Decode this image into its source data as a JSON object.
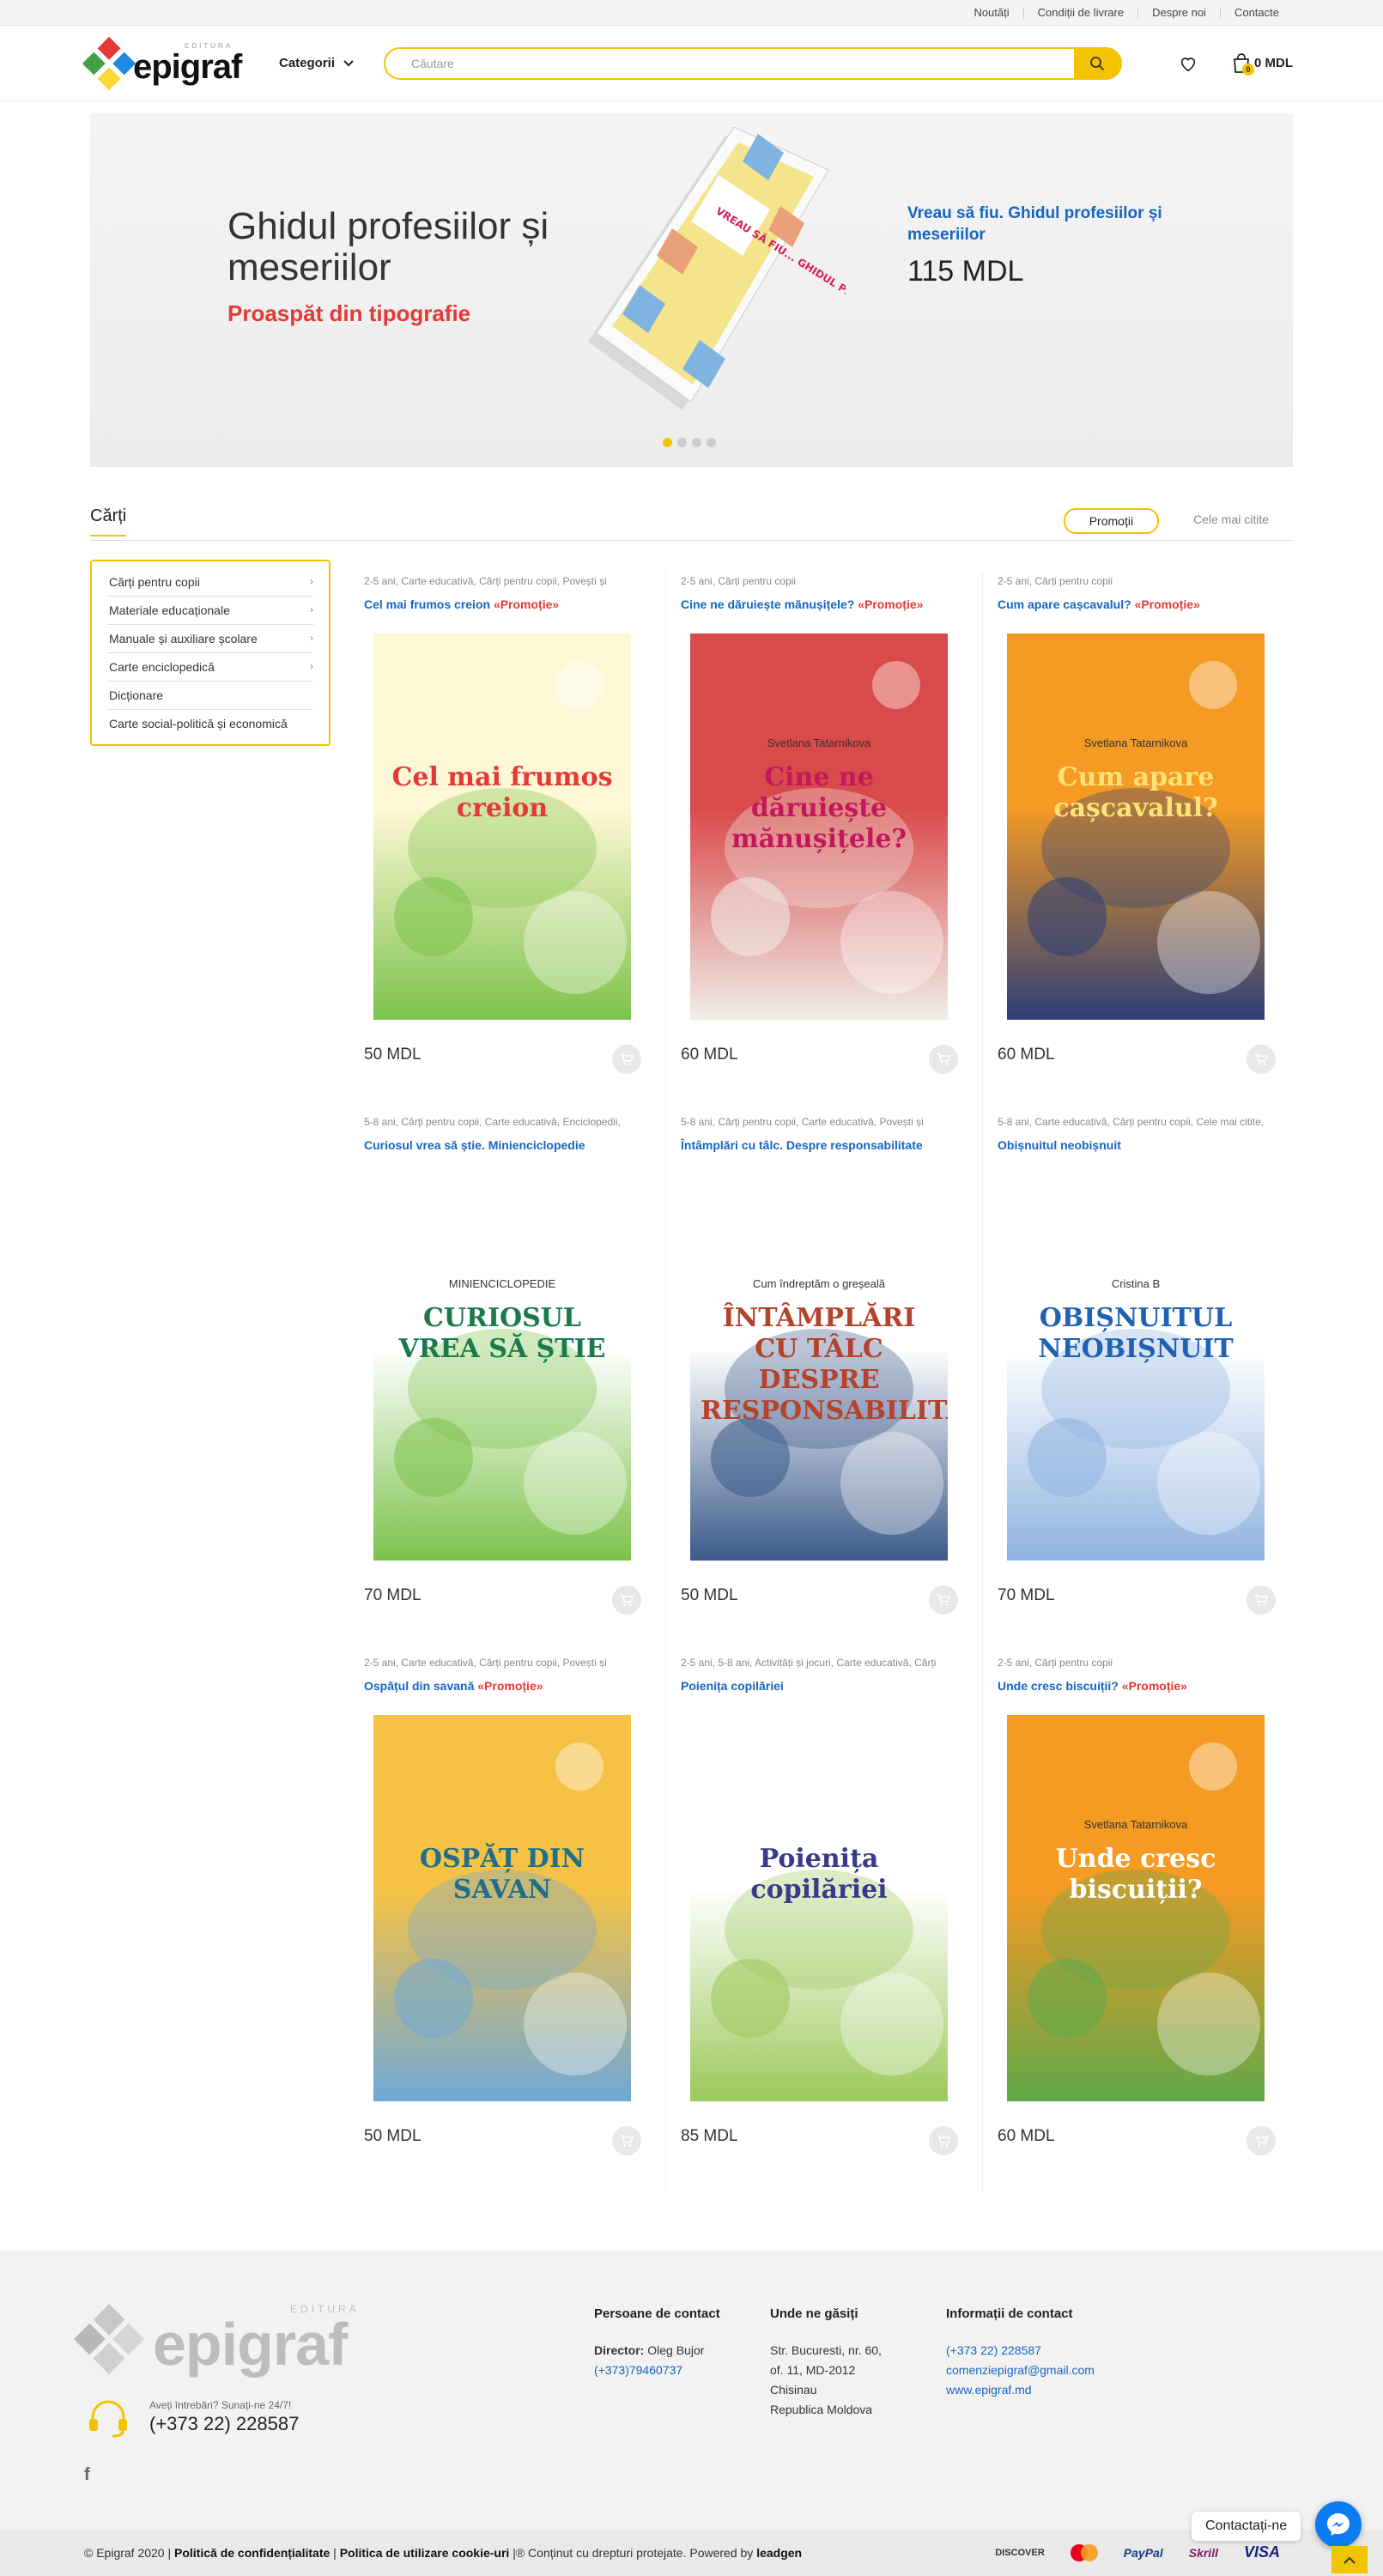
{
  "topbar": {
    "links": [
      "Noutăți",
      "Condiții de livrare",
      "Despre noi",
      "Contacte"
    ]
  },
  "header": {
    "logo_small": "EDITURA",
    "logo_big": "epigraf",
    "categories_label": "Categorii",
    "search_placeholder": "Căutare",
    "cart_total": "0 MDL",
    "cart_count": "0"
  },
  "banner": {
    "title": "Ghidul profesiilor și meseriilor",
    "subtitle": "Proaspăt din tipografie",
    "product_name": "Vreau să fiu. Ghidul profesiilor și meseriilor",
    "price": "115 MDL",
    "book_title": "VREAU SĂ FIU... GHIDUL PROFESIILOR ȘI MESERIILOR",
    "slides": 4,
    "active_slide": 1
  },
  "section": {
    "title": "Cărți",
    "tabs": [
      "Promoții",
      "Cele mai citite"
    ],
    "active_tab": "Promoții"
  },
  "sidebar": {
    "items": [
      "Cărți pentru copii",
      "Materiale educaționale",
      "Manuale și auxiliare școlare",
      "Carte enciclopedică",
      "Dicționare",
      "Carte social-politică și economică"
    ]
  },
  "products": [
    {
      "tags": "2-5 ani, Carte educativă, Cărți pentru copii, Povești și",
      "name": "Cel mai frumos creion",
      "promo": "«Promoție»",
      "price": "50 MDL",
      "cover_title": "Cel mai frumos creion",
      "cover_author": "",
      "colors": [
        "#fff8d6",
        "#7cc24b"
      ],
      "title_color": "#e53935"
    },
    {
      "tags": "2-5 ani, Cărți pentru copii",
      "name": "Cine ne dăruiește mănușițele?",
      "promo": "«Promoție»",
      "price": "60 MDL",
      "cover_title": "Cine ne dăruiește mănușițele?",
      "cover_author": "Svetlana Tatarnikova",
      "colors": [
        "#d94a4a",
        "#f0eee8"
      ],
      "title_color": "#c2185b"
    },
    {
      "tags": "2-5 ani, Cărți pentru copii",
      "name": "Cum apare cașcavalul?",
      "promo": "«Promoție»",
      "price": "60 MDL",
      "cover_title": "Cum apare cașcavalul?",
      "cover_author": "Svetlana Tatarnikova",
      "colors": [
        "#f59a23",
        "#2c3e78"
      ],
      "title_color": "#ffe37a"
    },
    {
      "tags": "5-8 ani, Cărți pentru copii, Carte educativă, Enciclopedii,",
      "name": "Curiosul vrea să știe. Minienciclopedie",
      "promo": "",
      "price": "70 MDL",
      "cover_title": "CURIOSUL VREA SĂ ȘTIE",
      "cover_author": "MINIENCICLOPEDIE",
      "colors": [
        "#ffffff",
        "#7cc24b"
      ],
      "title_color": "#1b7a4a"
    },
    {
      "tags": "5-8 ani, Cărți pentru copii, Carte educativă, Povești și",
      "name": "Întâmplări cu tâlc. Despre responsabilitate",
      "promo": "",
      "price": "50 MDL",
      "cover_title": "ÎNTÂMPLĂRI CU TÂLC DESPRE RESPONSABILITATE",
      "cover_author": "Cum îndreptăm o greșeală",
      "colors": [
        "#ffffff",
        "#3b5a8a"
      ],
      "title_color": "#b5422a"
    },
    {
      "tags": "5-8 ani, Carte educativă, Cărți pentru copii, Cele mai citite,",
      "name": "Obișnuitul neobișnuit",
      "promo": "",
      "price": "70 MDL",
      "cover_title": "OBIȘNUITUL NEOBIȘNUIT",
      "cover_author": "Cristina B",
      "colors": [
        "#ffffff",
        "#8fb3e0"
      ],
      "title_color": "#1f62b5"
    },
    {
      "tags": "2-5 ani, Carte educativă, Cărți pentru copii, Povești și",
      "name": "Ospățul din savană",
      "promo": "«Promoție»",
      "price": "50 MDL",
      "cover_title": "OSPĂȚ DIN SAVAN",
      "cover_author": "",
      "colors": [
        "#f6c244",
        "#6fa8d6"
      ],
      "title_color": "#1f6e8a"
    },
    {
      "tags": "2-5 ani, 5-8 ani, Activități și jocuri, Carte educativă, Cărți",
      "name": "Poienița copilăriei",
      "promo": "",
      "price": "85 MDL",
      "cover_title": "Poienița copilăriei",
      "cover_author": "",
      "colors": [
        "#ffffff",
        "#9bc95a"
      ],
      "title_color": "#3a3a8a"
    },
    {
      "tags": "2-5 ani, Cărți pentru copii",
      "name": "Unde cresc biscuiții?",
      "promo": "«Promoție»",
      "price": "60 MDL",
      "cover_title": "Unde cresc biscuiții?",
      "cover_author": "Svetlana Tatarnikova",
      "colors": [
        "#f59a23",
        "#5fa84a"
      ],
      "title_color": "#ffffff"
    }
  ],
  "footer": {
    "logo_small": "EDITURA",
    "logo_big": "epigraf",
    "phone_caption": "Aveți întrebări? Sunați-ne 24/7!",
    "phone": "(+373 22) 228587",
    "facebook": "f",
    "contacts": {
      "heading": "Persoane de contact",
      "director_label": "Director:",
      "director_name": "Oleg Bujor",
      "director_phone": "(+373)79460737"
    },
    "location": {
      "heading": "Unde ne găsiți",
      "line1": "Str. Bucuresti, nr. 60,",
      "line2": "of. 11, MD-2012",
      "line3": "Chisinau",
      "line4": "Republica Moldova"
    },
    "info": {
      "heading": "Informații de contact",
      "phone": "(+373 22) 228587",
      "email": "comenziepigraf@gmail.com",
      "site": "www.epigraf.md"
    }
  },
  "bottombar": {
    "copyright": "© Epigraf 2020 |",
    "privacy": "Politică de confidențialitate",
    "cookies": "Politica de utilizare cookie-uri",
    "rights": "|® Conținut cu drepturi protejate. Powered by",
    "powered": "leadgen",
    "payments": [
      "DISCOVER",
      "MasterCard",
      "PayPal",
      "Skrill",
      "VISA"
    ]
  },
  "chat": {
    "label": "Contactați-ne"
  },
  "colors": {
    "accent": "#f2c300",
    "link": "#1565c0",
    "promo": "#e53935"
  }
}
